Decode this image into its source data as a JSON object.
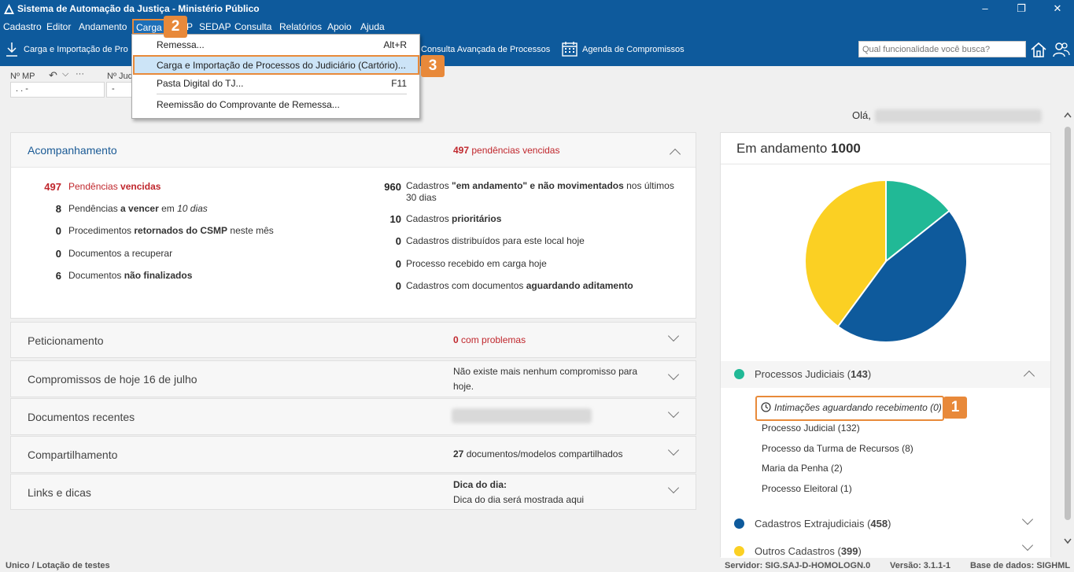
{
  "window": {
    "title": "Sistema de Automação da Justiça - Ministério Público",
    "minimize": "–",
    "maximize": "❐",
    "close": "✕"
  },
  "menu": {
    "items": [
      "Cadastro",
      "Editor",
      "Andamento",
      "Carga",
      "P",
      "SEDAP",
      "Consulta",
      "Relatórios",
      "Apoio",
      "Ajuda"
    ]
  },
  "toolbar": {
    "carga": "Carga e Importação de Pro",
    "consulta": "Consulta Avançada de Processos",
    "agenda": "Agenda de Compromissos",
    "search_placeholder": "Qual funcionalidade você busca?"
  },
  "fields": {
    "mp_label": "Nº MP",
    "mp_value": ". .   -",
    "jud_label": "Nº Jud",
    "jud_value": "-",
    "undo": "↶",
    "chevron": "⌵",
    "more": "···"
  },
  "dropdown": {
    "items": [
      {
        "label": "Remessa...",
        "shortcut": "Alt+R"
      },
      {
        "label": "Carga e Importação de Processos do Judiciário (Cartório)...",
        "shortcut": ""
      },
      {
        "label": "Pasta Digital do TJ...",
        "shortcut": "F11"
      },
      {
        "label": "Reemissão do Comprovante de Remessa...",
        "shortcut": ""
      }
    ]
  },
  "badges": {
    "b1": "1",
    "b2": "2",
    "b3": "3"
  },
  "greeting": "Olá,",
  "acompanhamento": {
    "title": "Acompanhamento",
    "summary_num": "497",
    "summary_text": "pendências vencidas",
    "left": [
      {
        "num": "497",
        "pre": "Pendências ",
        "bold": "vencidas",
        "post": ""
      },
      {
        "num": "8",
        "pre": "Pendências ",
        "bold": "a vencer",
        "post": " em ",
        "italic": "10 dias"
      },
      {
        "num": "0",
        "pre": "Procedimentos ",
        "bold": "retornados do CSMP",
        "post": " neste mês"
      },
      {
        "num": "0",
        "pre": "Documentos a recuperar",
        "bold": "",
        "post": ""
      },
      {
        "num": "6",
        "pre": "Documentos ",
        "bold": "não finalizados",
        "post": ""
      }
    ],
    "right": [
      {
        "num": "960",
        "pre": "Cadastros ",
        "bold": "\"em andamento\" e não movimentados",
        "post": " nos últimos",
        "line2": "30 dias"
      },
      {
        "num": "10",
        "pre": "Cadastros ",
        "bold": "prioritários",
        "post": ""
      },
      {
        "num": "0",
        "pre": "Cadastros distribuídos para este local hoje",
        "bold": "",
        "post": ""
      },
      {
        "num": "0",
        "pre": "Processo recebido em carga hoje",
        "bold": "",
        "post": ""
      },
      {
        "num": "0",
        "pre": "Cadastros com documentos ",
        "bold": "aguardando aditamento",
        "post": ""
      }
    ]
  },
  "panels": [
    {
      "title": "Peticionamento",
      "num": "0",
      "info": "com problemas"
    },
    {
      "title": "Compromissos de hoje 16 de julho",
      "line1": "Não existe mais nenhum compromisso para",
      "line2": "hoje."
    },
    {
      "title": "Documentos recentes"
    },
    {
      "title": "Compartilhamento",
      "num": "27",
      "info": "documentos/modelos compartilhados"
    },
    {
      "title": "Links e dicas",
      "line1": "Dica do dia:",
      "line2": "Dica do dia será mostrada aqui"
    }
  ],
  "andamento": {
    "title_prefix": "Em andamento",
    "total": "1000",
    "sections": [
      {
        "label": "Processos Judiciais",
        "count": "143",
        "color": "#21b996"
      },
      {
        "label": "Cadastros Extrajudiciais",
        "count": "458",
        "color": "#0e5a9c"
      },
      {
        "label": "Outros Cadastros",
        "count": "399",
        "color": "#fbd023"
      }
    ],
    "sub_items": [
      "Intimações aguardando recebimento (0)",
      "Processo Judicial (132)",
      "Processo da Turma de Recursos (8)",
      "Maria da Penha (2)",
      "Processo Eleitoral (1)"
    ]
  },
  "chart_data": {
    "type": "pie",
    "title": "",
    "categories": [
      "Processos Judiciais",
      "Cadastros Extrajudiciais",
      "Outros Cadastros"
    ],
    "values": [
      143,
      458,
      399
    ],
    "colors": [
      "#21b996",
      "#0e5a9c",
      "#fbd023"
    ]
  },
  "status": {
    "left": "Unico / Lotação de testes",
    "server": "Servidor: SIG.SAJ-D-HOMOLOGN.0",
    "version": "Versão: 3.1.1-1",
    "db": "Base de dados: SIGHML"
  }
}
